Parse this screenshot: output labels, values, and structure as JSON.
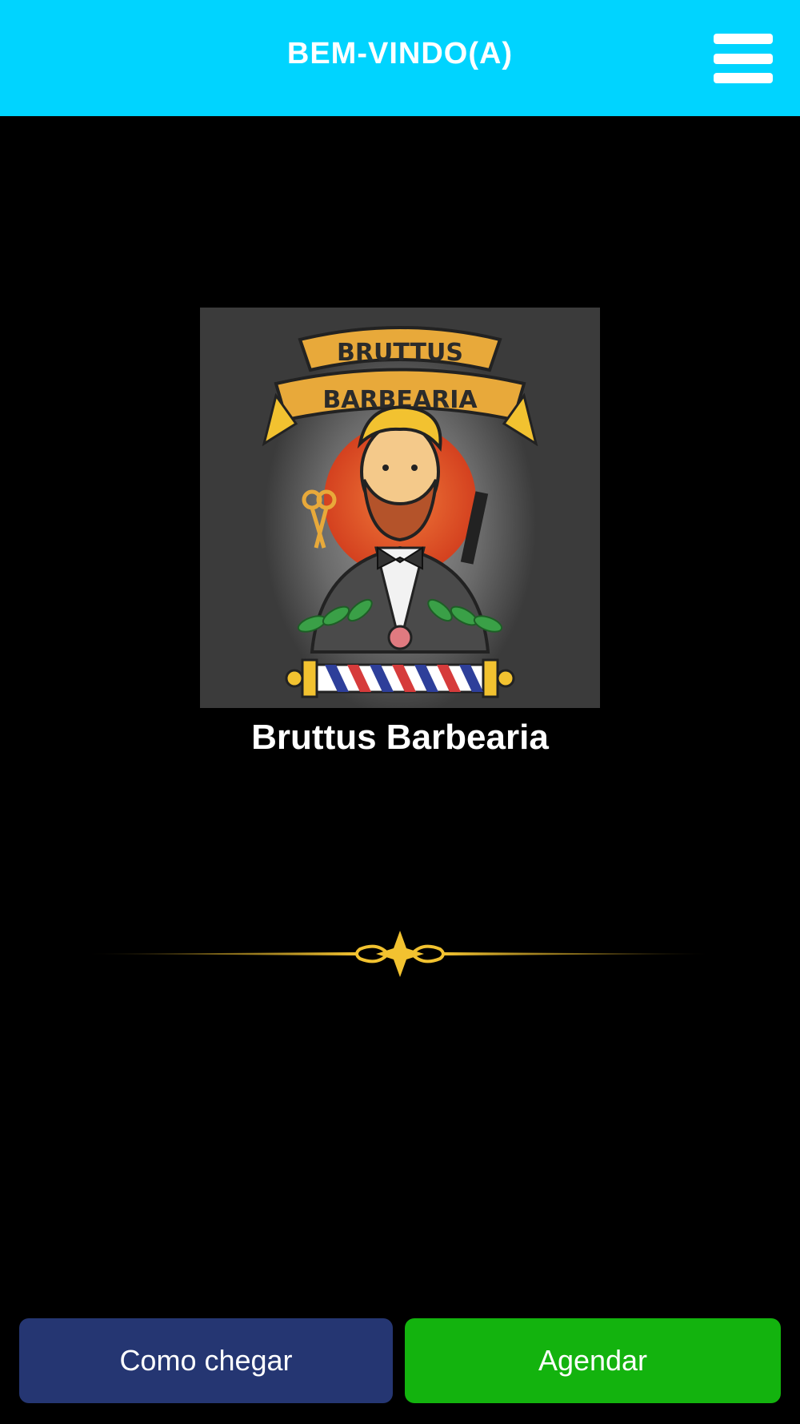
{
  "header": {
    "title": "BEM-VINDO(A)",
    "background_color": "#00D4FF",
    "menu_icon": "hamburger-menu-icon"
  },
  "logo": {
    "banner_line1": "BRUTTUS",
    "banner_line2": "BARBEARIA",
    "description_icon": "barber-mascot-logo"
  },
  "business": {
    "name": "Bruttus Barbearia"
  },
  "divider": {
    "icon": "ornamental-divider-icon",
    "color": "#F2C230"
  },
  "actions": {
    "directions_label": "Como chegar",
    "directions_color": "#253672",
    "schedule_label": "Agendar",
    "schedule_color": "#13B30E"
  }
}
